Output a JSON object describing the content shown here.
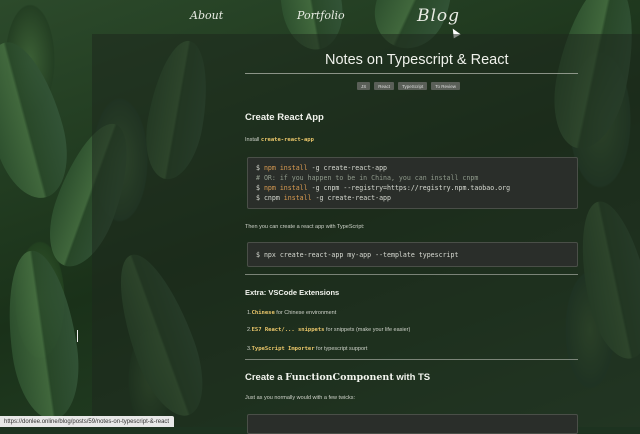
{
  "nav": {
    "about": "About",
    "portfolio": "Portfolio",
    "blog": "Blog"
  },
  "post": {
    "title": "Notes on Typescript & React",
    "tags": [
      "JS",
      "React",
      "TypeScript",
      "To Review"
    ]
  },
  "section_create": {
    "heading": "Create React App",
    "install_prefix": "Install ",
    "install_code": "create-react-app",
    "code": [
      {
        "prompt": "$ ",
        "kw": "npm install",
        "rest": " -g create-react-app"
      },
      {
        "comment": "# OR: if you happen to be in China, you can install cnpm"
      },
      {
        "prompt": "$ ",
        "kw": "npm install",
        "rest": " -g cnpm --registry=https://registry.npm.taobao.org"
      },
      {
        "prompt": "$ cnpm ",
        "kw": "install",
        "rest": " -g create-react-app"
      }
    ],
    "ts_text": "Then you can create a react app with TypeScript:",
    "ts_code": "$ npx create-react-app my-app --template typescript"
  },
  "section_extra": {
    "heading": "Extra: VSCode Extensions",
    "items": [
      {
        "num": "1.",
        "code": "Chinese",
        "text": " for Chinese environment"
      },
      {
        "num": "2.",
        "code": "ES7 React/... snippets",
        "text": " for snippets (make your life easier)"
      },
      {
        "num": "3.",
        "code": "TypeScript Importer",
        "text": " for typescript support"
      }
    ]
  },
  "section_func": {
    "heading_prefix": "Create a ",
    "heading_code": "FunctionComponent",
    "heading_suffix": " with TS",
    "text": "Just as you normally would with a few twicks:"
  },
  "status_bar": {
    "url": "https://donlee.online/blog/posts/59/notes-on-typescript-&-react"
  }
}
